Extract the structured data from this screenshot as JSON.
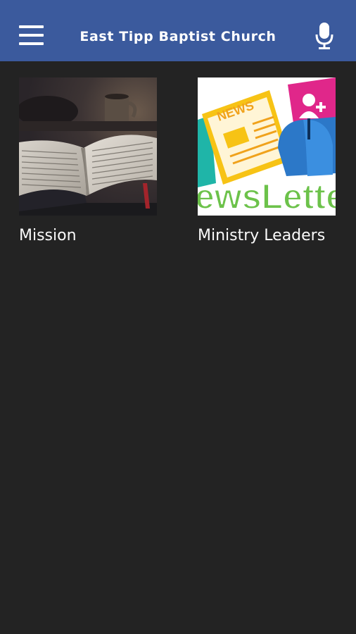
{
  "header": {
    "title": "East Tipp Baptist Church",
    "menu_icon": "hamburger-menu-icon",
    "voice_icon": "microphone-icon"
  },
  "tiles": [
    {
      "label": "Mission",
      "image": "open-bible-on-table"
    },
    {
      "label": "Ministry Leaders",
      "image": "newsletter-illustration"
    }
  ],
  "newsletter_image_text": {
    "news": "NEWS",
    "wordmark": "ewsLette"
  },
  "colors": {
    "appbar": "#3b5a9d",
    "background": "#232323",
    "text": "#ffffff"
  }
}
